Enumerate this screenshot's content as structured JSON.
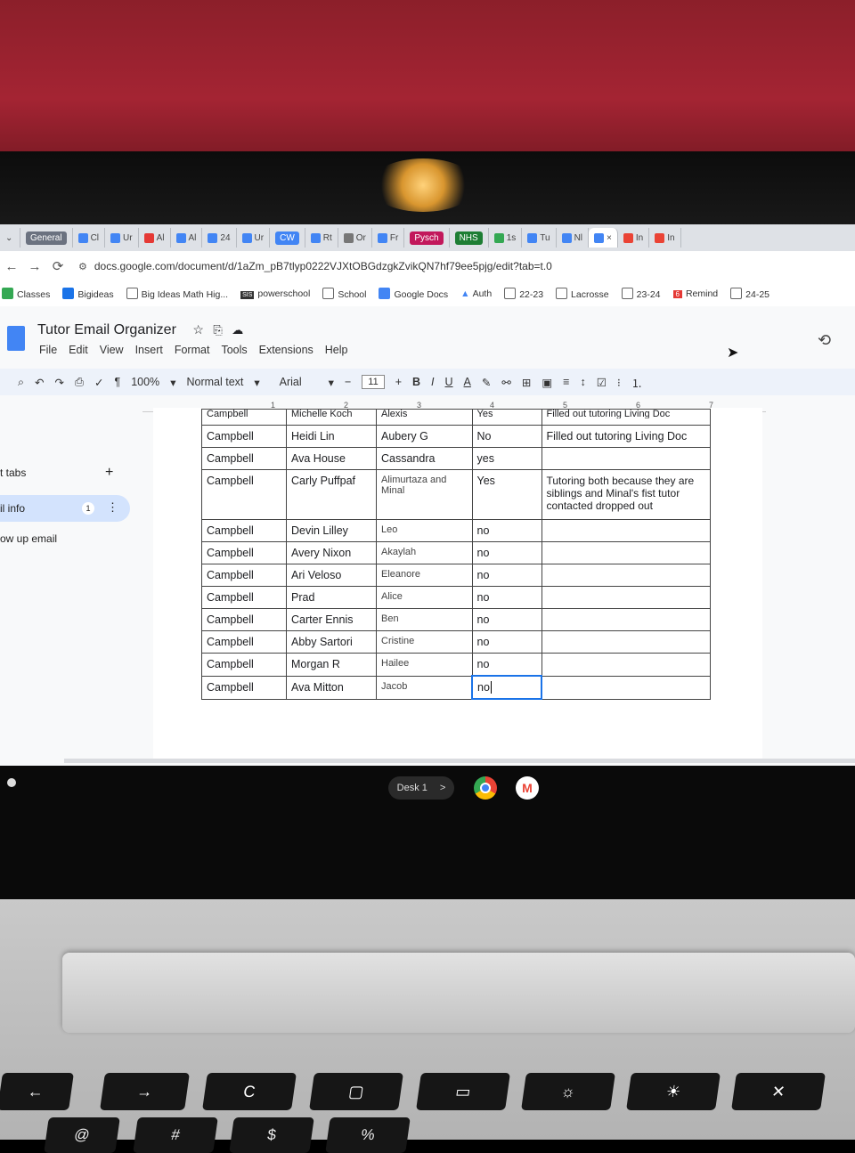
{
  "browser": {
    "tabs": [
      "General",
      "Cl",
      "Ur",
      "Al",
      "Al",
      "24",
      "Ur",
      "CW",
      "Rt",
      "Or",
      "Fr",
      "Pysch",
      "NHS",
      "1s",
      "Tu",
      "Nl",
      "×",
      "In",
      "In"
    ],
    "url": "docs.google.com/document/d/1aZm_pB7tlyp0222VJXtOBGdzgkZvikQN7hf79ee5pjg/edit?tab=t.0",
    "bookmarks": [
      "Classes",
      "Bigideas",
      "Big Ideas Math Hig...",
      "powerschool",
      "School",
      "Google Docs",
      "Auth",
      "22-23",
      "Lacrosse",
      "23-24",
      "Remind",
      "24-25"
    ],
    "remind_badge": "6",
    "sis_badge": "SIS"
  },
  "doc": {
    "title": "Tutor Email Organizer",
    "menus": [
      "File",
      "Edit",
      "View",
      "Insert",
      "Format",
      "Tools",
      "Extensions",
      "Help"
    ],
    "zoom": "100%",
    "style": "Normal text",
    "font": "Arial",
    "font_size": "11"
  },
  "toolbar_icons": {
    "bold": "B",
    "italic": "I",
    "underline": "U",
    "textcolor": "A",
    "minus": "−",
    "plus": "+"
  },
  "outline": {
    "tabs_label": "t tabs",
    "add": "+",
    "active_label": "il info",
    "active_badge": "1",
    "next_label": "ow up email",
    "more": "⋮"
  },
  "ruler": [
    "1",
    "2",
    "3",
    "4",
    "5",
    "6",
    "7"
  ],
  "table": {
    "cut_row": [
      "Campbell",
      "Michelle Koch",
      "Alexis",
      "Yes",
      "Filled out tutoring Living Doc"
    ],
    "rows": [
      [
        "Campbell",
        "Heidi Lin",
        "Aubery G",
        "No",
        "Filled out tutoring Living Doc"
      ],
      [
        "Campbell",
        "Ava House",
        "Cassandra",
        "yes",
        ""
      ],
      [
        "Campbell",
        "Carly Puffpaf",
        "Alimurtaza and Minal",
        "Yes",
        "Tutoring both because they are siblings and Minal's fist tutor contacted dropped out"
      ],
      [
        "Campbell",
        "Devin Lilley",
        "Leo",
        "no",
        ""
      ],
      [
        "Campbell",
        "Avery Nixon",
        "Akaylah",
        "no",
        ""
      ],
      [
        "Campbell",
        "Ari Veloso",
        "Eleanore",
        "no",
        ""
      ],
      [
        "Campbell",
        "Prad",
        "Alice",
        "no",
        ""
      ],
      [
        "Campbell",
        "Carter Ennis",
        "Ben",
        "no",
        ""
      ],
      [
        "Campbell",
        "Abby Sartori",
        "Cristine",
        "no",
        ""
      ],
      [
        "Campbell",
        "Morgan R",
        "Hailee",
        "no",
        ""
      ],
      [
        "Campbell",
        "Ava Mitton",
        "Jacob",
        "no",
        ""
      ]
    ]
  },
  "shelf": {
    "desk": "Desk 1",
    "chevron": ">"
  },
  "keys": {
    "back": "←",
    "forward": "→",
    "refresh": "C",
    "at": "@",
    "hash": "#",
    "dollar": "$",
    "percent": "%"
  }
}
